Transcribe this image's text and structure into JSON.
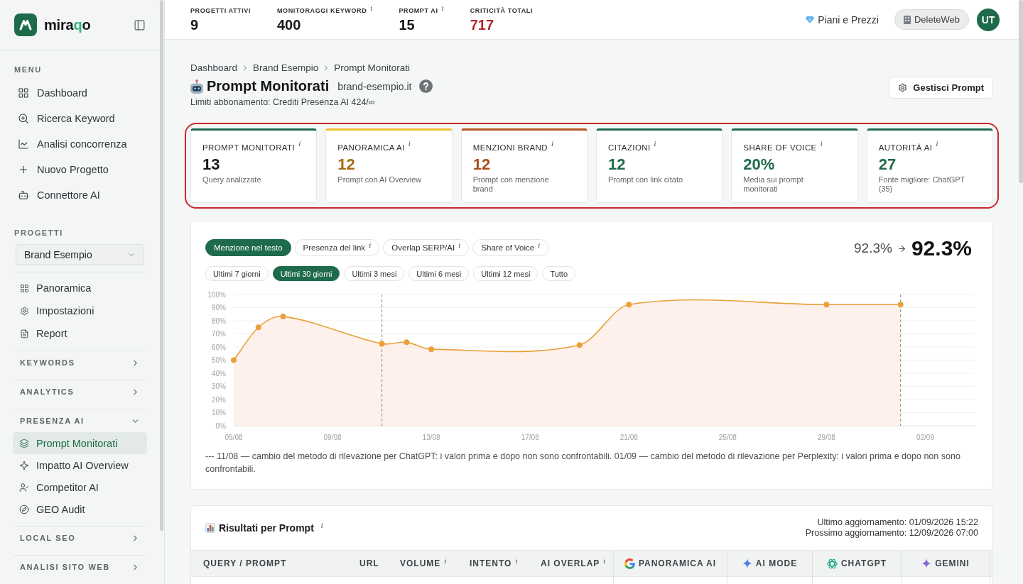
{
  "sidebar": {
    "logo": {
      "parts": [
        {
          "text": "mira",
          "accent": false
        },
        {
          "text": "q",
          "accent": true
        },
        {
          "text": "o",
          "accent": false
        }
      ]
    },
    "menu": {
      "label": "MENU",
      "items": [
        {
          "label": "Dashboard",
          "selected": false
        },
        {
          "label": "Ricerca Keyword",
          "selected": false
        },
        {
          "label": "Analisi concorrenza",
          "selected": false
        },
        {
          "label": "Nuovo Progetto",
          "selected": false
        },
        {
          "label": "Connettore AI",
          "selected": false
        }
      ]
    },
    "projects": {
      "label": "PROGETTI",
      "project_select": {
        "value": "Brand Esempio"
      },
      "items": [
        {
          "label": "Panoramica",
          "selected": false
        },
        {
          "label": "Impostazioni",
          "selected": false
        },
        {
          "label": "Report",
          "selected": false
        }
      ]
    },
    "sections": [
      {
        "label": "KEYWORDS",
        "expanded": false
      },
      {
        "label": "ANALYTICS",
        "expanded": false
      },
      {
        "label": "PRESENZA AI",
        "expanded": true,
        "children": [
          {
            "label": "Prompt Monitorati",
            "selected": true
          },
          {
            "label": "Impatto AI Overview",
            "selected": false
          },
          {
            "label": "Competitor AI",
            "selected": false
          },
          {
            "label": "GEO Audit",
            "selected": false
          }
        ]
      },
      {
        "label": "LOCAL SEO",
        "expanded": false
      },
      {
        "label": "ANALISI SITO WEB",
        "expanded": false
      }
    ]
  },
  "top_bar": {
    "stats": [
      {
        "label": "PROGETTI ATTIVI",
        "value": "9",
        "kind": "plain"
      },
      {
        "label": "MONITORAGGI KEYWORD",
        "info": "i",
        "value": "400",
        "kind": "plain"
      },
      {
        "label": "PROMPT AI",
        "info": "i",
        "value": "15",
        "kind": "plain"
      },
      {
        "label": "CRITICITÀ TOTALI",
        "value": "717",
        "kind": "alert"
      }
    ],
    "plans_link": "Piani e Prezzi",
    "workspace_button": "DeleteWeb",
    "avatar": "UT"
  },
  "page_header": {
    "breadcrumb": [
      "Dashboard",
      "Brand Esempio",
      "Prompt Monitorati"
    ],
    "title": "Prompt Monitorati",
    "domain": "brand-esempio.it",
    "limits": "Limiti abbonamento: Crediti Presenza AI 424/∞",
    "manage_button": "Gestisci Prompt"
  },
  "summary_cards": {
    "highlighted": true,
    "cards": [
      {
        "label": "PROMPT MONITORATI",
        "info": "i",
        "value": "13",
        "caption": "Query analizzate",
        "color": "#1d6b4a",
        "kind": "neutral"
      },
      {
        "label": "PANORAMICA AI",
        "info": "i",
        "value": "12",
        "caption": "Prompt con AI Overview",
        "color": "#f2c12e",
        "kind": "warning"
      },
      {
        "label": "MENZIONI BRAND",
        "info": "i",
        "value": "12",
        "caption": "Prompt con menzione brand",
        "color": "#b4531d",
        "kind": "alert"
      },
      {
        "label": "CITAZIONI",
        "info": "i",
        "value": "12",
        "caption": "Prompt con link citato",
        "color": "#1d6b4a",
        "kind": "good"
      },
      {
        "label": "SHARE OF VOICE",
        "info": "i",
        "value": "20%",
        "caption": "Media sui prompt monitorati",
        "color": "#1d6b4a",
        "kind": "good"
      },
      {
        "label": "AUTORITÀ AI",
        "info": "i",
        "value": "27",
        "caption": "Fonte migliore: ChatGPT (35)",
        "color": "#1d6b4a",
        "kind": "good"
      }
    ]
  },
  "trend": {
    "metric_tabs": [
      {
        "label": "Menzione nel testo",
        "selected": true
      },
      {
        "label": "Presenza del link",
        "info": "i",
        "selected": false
      },
      {
        "label": "Overlap SERP/AI",
        "info": "i",
        "selected": false
      },
      {
        "label": "Share of Voice",
        "info": "i",
        "selected": false
      }
    ],
    "period_tabs": [
      {
        "label": "Ultimi 7 giorni",
        "selected": false
      },
      {
        "label": "Ultimi 30 giorni",
        "selected": true
      },
      {
        "label": "Ultimi 3 mesi",
        "selected": false
      },
      {
        "label": "Ultimi 6 mesi",
        "selected": false
      },
      {
        "label": "Ultimi 12 mesi",
        "selected": false
      },
      {
        "label": "Tutto",
        "selected": false
      }
    ],
    "comparison": {
      "previous": "92.3%",
      "current": "92.3%"
    },
    "chart_data": {
      "type": "area",
      "grid": true,
      "categories": [
        "05/08",
        null,
        null,
        null,
        "09/08",
        null,
        null,
        null,
        "13/08",
        null,
        null,
        null,
        "17/08",
        null,
        null,
        null,
        "21/08",
        null,
        null,
        null,
        "25/08",
        null,
        null,
        null,
        "29/08",
        null,
        null,
        null,
        "02/09",
        null,
        null
      ],
      "series": [
        {
          "color": "#e9a23b",
          "values": [
            50,
            75,
            83.3,
            null,
            null,
            null,
            62.5,
            63.6,
            58.3,
            null,
            null,
            null,
            null,
            null,
            61.5,
            null,
            92.3,
            null,
            null,
            null,
            null,
            null,
            null,
            null,
            92.3,
            null,
            null,
            92.3,
            null,
            null,
            null
          ]
        }
      ],
      "ylim": [
        0,
        100
      ],
      "yticks": [
        {
          "value": 0,
          "label": "0%"
        },
        {
          "value": 10,
          "label": "10%"
        },
        {
          "value": 20,
          "label": "20%"
        },
        {
          "value": 30,
          "label": "30%"
        },
        {
          "value": 40,
          "label": "40%"
        },
        {
          "value": 50,
          "label": "50%"
        },
        {
          "value": 60,
          "label": "60%"
        },
        {
          "value": 70,
          "label": "70%"
        },
        {
          "value": 80,
          "label": "80%"
        },
        {
          "value": 90,
          "label": "90%"
        },
        {
          "value": 100,
          "label": "100%"
        }
      ],
      "annotations": [
        {
          "x": "11/08"
        },
        {
          "x": "01/09"
        }
      ]
    },
    "note": "--- 11/08 — cambio del metodo di rilevazione per ChatGPT: i valori prima e dopo non sono confrontabili. 01/09 — cambio del metodo di rilevazione per Perplexity: i valori prima e dopo non sono confrontabili."
  },
  "results": {
    "title": "Risultati per Prompt",
    "info": "i",
    "updates": [
      "Ultimo aggiornamento: 01/09/2026 15:22",
      "Prossimo aggiornamento: 12/09/2026 07:00"
    ],
    "columns": [
      {
        "label": "QUERY / PROMPT"
      },
      {
        "label": "URL"
      },
      {
        "label": "VOLUME",
        "info": "i"
      },
      {
        "label": "INTENTO",
        "info": "i"
      },
      {
        "label": "AI OVERLAP",
        "info": "i"
      }
    ],
    "engines": [
      {
        "label": "PANORAMICA AI"
      },
      {
        "label": "AI MODE"
      },
      {
        "label": "CHATGPT"
      },
      {
        "label": "GEMINI"
      }
    ]
  }
}
